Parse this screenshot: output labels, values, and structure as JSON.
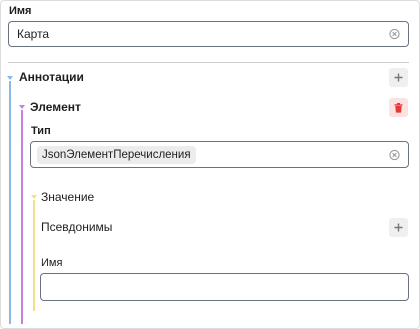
{
  "name_field": {
    "label": "Имя",
    "value": "Карта"
  },
  "annotations": {
    "title": "Аннотации"
  },
  "element": {
    "title": "Элемент"
  },
  "type_field": {
    "label": "Тип",
    "chip": "JsonЭлементПеречисления"
  },
  "value_section": {
    "title": "Значение"
  },
  "aliases": {
    "title": "Псевдонимы"
  },
  "inner_name_field": {
    "label": "Имя",
    "value": ""
  },
  "colors": {
    "annotations_line": "#8cb8e8",
    "element_line": "#c57fe0",
    "value_line": "#efe08a",
    "danger": "#e53935"
  },
  "icons": {
    "clear": "close-circle-icon",
    "add": "plus-icon",
    "delete": "trash-icon"
  }
}
